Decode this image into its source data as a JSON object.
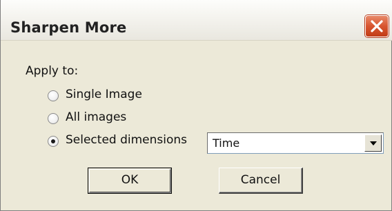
{
  "window": {
    "title": "Sharpen More",
    "close_icon": "close-icon"
  },
  "apply_to": {
    "label": "Apply to:",
    "options": [
      {
        "label": "Single Image",
        "selected": false
      },
      {
        "label": "All images",
        "selected": false
      },
      {
        "label": "Selected dimensions",
        "selected": true
      }
    ]
  },
  "dimension_select": {
    "value": "Time",
    "icon": "chevron-down-icon"
  },
  "buttons": {
    "ok_label": "OK",
    "cancel_label": "Cancel"
  },
  "colors": {
    "dialog_bg": "#ece9d8",
    "close_button": "#d8552f"
  }
}
